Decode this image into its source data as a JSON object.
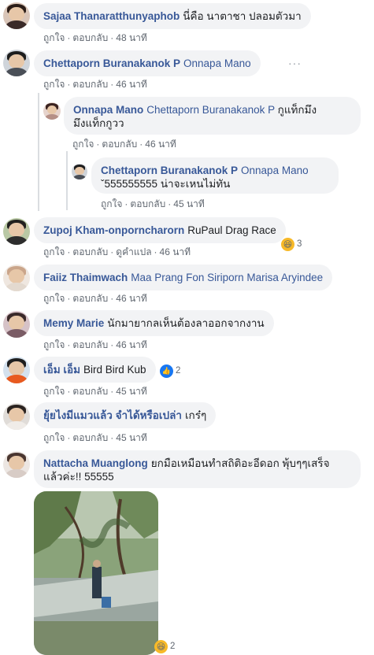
{
  "comments": [
    {
      "name": "Sajaa Thanaratthunyaphob",
      "text": "นี่คือ นาตาชา ปลอมตัวมา",
      "like": "ถูกใจ",
      "reply": "ตอบกลับ",
      "time": "48 นาที"
    },
    {
      "name": "Chettaporn Buranakanok P",
      "mention": "Onnapa Mano",
      "like": "ถูกใจ",
      "reply": "ตอบกลับ",
      "time": "46 นาที",
      "more": "···"
    },
    {
      "name": "Onnapa Mano",
      "mention": "Chettaporn Buranakanok P",
      "text_inline": "กูแท็กมึง",
      "text_line2": "มึงแท็กกูวว",
      "like": "ถูกใจ",
      "reply": "ตอบกลับ",
      "time": "46 นาที"
    },
    {
      "name": "Chettaporn Buranakanok P",
      "mention": "Onnapa Mano",
      "text_line2": "ˇ555555555 น่าจะเหนไม่ทัน",
      "like": "ถูกใจ",
      "reply": "ตอบกลับ",
      "time": "45 นาที"
    },
    {
      "name": "Zupoj Kham-onporncharorn",
      "text": "RuPaul Drag Race",
      "like": "ถูกใจ",
      "reply": "ตอบกลับ",
      "translate": "ดูคำแปล",
      "time": "46 นาที",
      "reaction_icon": "haha-icon",
      "reaction_count": "3"
    },
    {
      "name": "Faiiz Thaimwach",
      "mention": "Maa Prang Fon Siriporn Marisa Aryindee",
      "like": "ถูกใจ",
      "reply": "ตอบกลับ",
      "time": "46 นาที"
    },
    {
      "name": "Memy Marie",
      "text": "นักมายากลเห็นต้องลาออกจากงาน",
      "like": "ถูกใจ",
      "reply": "ตอบกลับ",
      "time": "46 นาที"
    },
    {
      "name": "เอ็ม เอ็ม",
      "text": "Bird Bird Kub",
      "like": "ถูกใจ",
      "reply": "ตอบกลับ",
      "time": "45 นาที",
      "reaction_icon": "like-icon",
      "reaction_count": "2"
    },
    {
      "name": "ยุ้ยไงมีแมวแล้ว จำได้หรือเปล่า",
      "text": "เกร๋ๆ",
      "like": "ถูกใจ",
      "reply": "ตอบกลับ",
      "time": "45 นาที"
    },
    {
      "name": "Nattacha Muanglong",
      "text_inline": "ยกมือเหมือนทำสถิติอะอีดอก พุ้บๆๆเสร็จ",
      "text_line2": "แล้วค่ะ!! 55555",
      "reaction_icon": "haha-icon",
      "reaction_count": "2"
    }
  ],
  "icons": {
    "haha": "😆",
    "like": "👍"
  },
  "colors": {
    "link": "#385898",
    "bubble": "#f2f3f5",
    "meta": "#606770"
  }
}
